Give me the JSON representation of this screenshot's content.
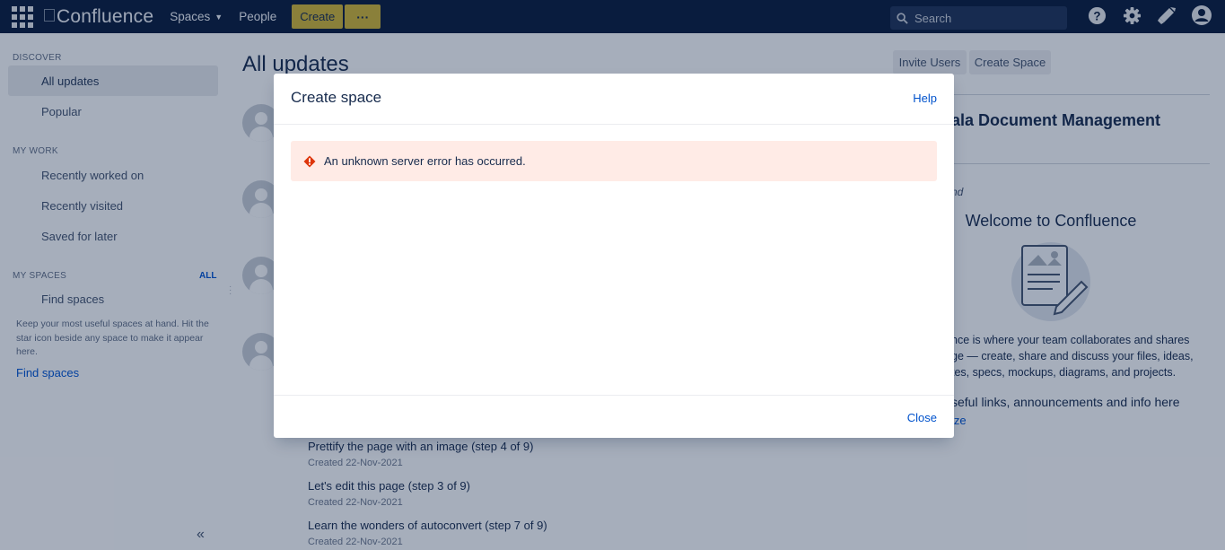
{
  "topnav": {
    "logo_text": "Confluence",
    "spaces_label": "Spaces",
    "people_label": "People",
    "create_label": "Create",
    "more_label": "···",
    "search_placeholder": "Search",
    "icons": [
      "help-icon",
      "settings-icon",
      "notifications-icon",
      "user-avatar-icon"
    ]
  },
  "sidebar": {
    "discover_heading": "DISCOVER",
    "discover_items": [
      {
        "label": "All updates",
        "active": true
      },
      {
        "label": "Popular",
        "active": false
      }
    ],
    "mywork_heading": "MY WORK",
    "mywork_items": [
      {
        "label": "Recently worked on"
      },
      {
        "label": "Recently visited"
      },
      {
        "label": "Saved for later"
      }
    ],
    "myspaces_heading": "MY SPACES",
    "all_label": "ALL",
    "find_spaces_item": "Find spaces",
    "help_text": "Keep your most useful spaces at hand. Hit the star icon beside any space to make it appear here.",
    "find_spaces_link": "Find spaces",
    "collapse_label": "«"
  },
  "main": {
    "title": "All updates",
    "feed": [
      {
        "title": "Prettify the page with an image (step 4 of 9)",
        "meta": "Created 22-Nov-2021"
      },
      {
        "title": "Let's edit this page (step 3 of 9)",
        "meta": "Created 22-Nov-2021"
      },
      {
        "title": "Learn the wonders of autoconvert (step 7 of 9)",
        "meta": "Created 22-Nov-2021"
      }
    ]
  },
  "right": {
    "invite_users_label": "Invite Users",
    "create_space_label": "Create Space",
    "space_name_fragment": "ala Document Management",
    "italic_fragment": "nd",
    "welcome_title": "Welcome to Confluence",
    "description_fragment": "nce is where your team collaborates and shares\nge — create, share and discuss your files, ideas,\ntes, specs, mockups, diagrams, and projects.",
    "links_fragment": "seful links, announcements and info here",
    "customize_fragment": "ize"
  },
  "dialog": {
    "title": "Create space",
    "help_label": "Help",
    "error_message": "An unknown server error has occurred.",
    "close_label": "Close",
    "error_color": "#de350b"
  }
}
